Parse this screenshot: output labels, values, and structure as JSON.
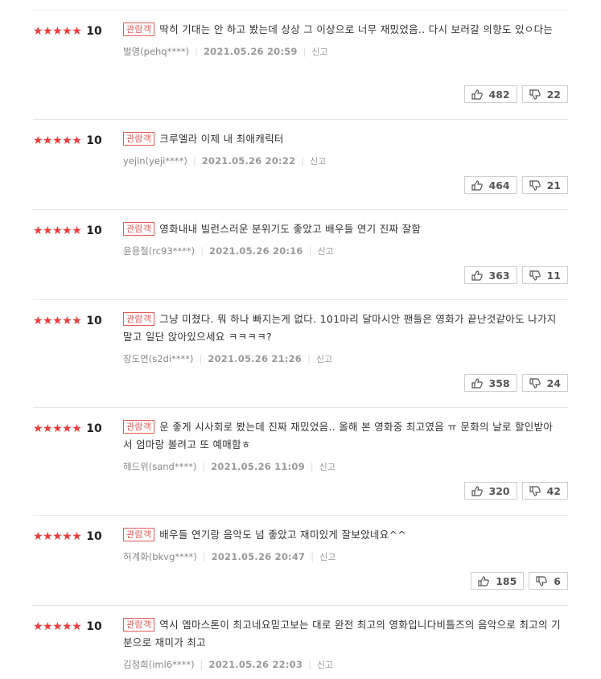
{
  "reviews": [
    {
      "stars": "★★★★★",
      "score": "10",
      "badge": "관람객",
      "text": "딱히 기대는 안 하고 봤는데 상상 그 이상으로 너무 재밌었음.. 다시 보러갈 의향도 있ㅇ다는",
      "author": "벌명(pehq****)",
      "date": "2021.05.26 20:59",
      "report": "신고",
      "likes": "482",
      "dislikes": "22"
    },
    {
      "stars": "★★★★★",
      "score": "10",
      "badge": "관람객",
      "text": "크루엘라 이제 내 최애캐릭터",
      "author": "yejin(yeji****)",
      "date": "2021.05.26 20:22",
      "report": "신고",
      "likes": "464",
      "dislikes": "21"
    },
    {
      "stars": "★★★★★",
      "score": "10",
      "badge": "관람객",
      "text": "영화내내 빌런스러운 분위기도 좋았고 배우들 연기 진짜 잘함",
      "author": "윤용철(rc93****)",
      "date": "2021.05.26 20:16",
      "report": "신고",
      "likes": "363",
      "dislikes": "11"
    },
    {
      "stars": "★★★★★",
      "score": "10",
      "badge": "관람객",
      "text": "그냥 미쳤다. 뭐 하나 빠지는게 없다. 101마리 달마시안 팬들은 영화가 끝난것같아도 나가지말고 일단 앉아있으세요 ㅋㅋㅋㅋ?",
      "author": "장도연(s2di****)",
      "date": "2021.05.26 21:26",
      "report": "신고",
      "likes": "358",
      "dislikes": "24"
    },
    {
      "stars": "★★★★★",
      "score": "10",
      "badge": "관람객",
      "text": "운 좋게 시사회로 봤는데 진짜 재밌었음.. 올해 본 영화중 최고였음 ㅠ 문화의 날로 할인받아서 엄마랑 볼려고 또 예매함ㅎ",
      "author": "헤드위(sand****)",
      "date": "2021.05.26 11:09",
      "report": "신고",
      "likes": "320",
      "dislikes": "42"
    },
    {
      "stars": "★★★★★",
      "score": "10",
      "badge": "관람객",
      "text": "배우들 연기랑 음악도 넘 좋았고 재미있게 잘보았네요^^",
      "author": "허계화(bkvg****)",
      "date": "2021.05.26 20:47",
      "report": "신고",
      "likes": "185",
      "dislikes": "6"
    },
    {
      "stars": "★★★★★",
      "score": "10",
      "badge": "관람객",
      "text": "역시 엠마스톤이 최고네요믿고보는 대로 완전 최고의 영화입니다비틀즈의 음악으로 최고의 기분으로 재미가 최고",
      "author": "김정희(iml6****)",
      "date": "2021.05.26 22:03",
      "report": "신고",
      "likes": null,
      "dislikes": null
    }
  ]
}
